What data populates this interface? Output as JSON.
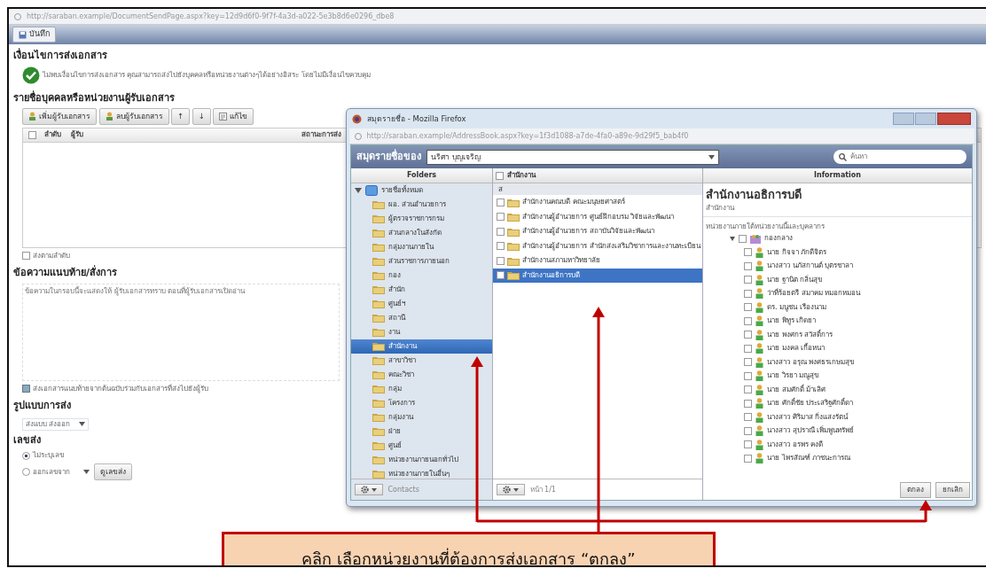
{
  "browser": {
    "url": "http://saraban.example/DocumentSendPage.aspx?key=12d9d6f0-9f7f-4a3d-a022-5e3b8d6e0296_dbe8"
  },
  "toolbar": {
    "buttons": [
      "บันทึก"
    ]
  },
  "conditions": {
    "heading": "เงื่อนไขการส่งเอกสาร",
    "message": "ไม่พบเงื่อนไขการส่งเอกสาร คุณสามารถส่งไปยังบุคคลหรือหน่วยงานต่างๆได้อย่างอิสระ โดยไม่มีเงื่อนไขควบคุม"
  },
  "recipients": {
    "heading": "รายชื่อบุคคลหรือหน่วยงานผู้รับเอกสาร",
    "buttons": [
      {
        "label": "เพิ่มผู้รับเอกสาร",
        "kind": "add"
      },
      {
        "label": "ลบผู้รับเอกสาร",
        "kind": "remove"
      },
      {
        "label": "↑",
        "kind": "up"
      },
      {
        "label": "↓",
        "kind": "down"
      },
      {
        "label": "แก้ไข",
        "kind": "edit"
      }
    ],
    "columns": [
      "ลำดับ",
      "ผู้รับ",
      "สถานะการส่ง"
    ],
    "select_all": {
      "checked": false
    },
    "send_in_order": {
      "label": "ส่งตามลำดับ",
      "checked": false
    }
  },
  "note": {
    "heading": "ข้อความแนบท้าย/สั่งการ",
    "placeholder": "ข้อความในกรอบนี้จะแสดงให้ ผู้รับเอกสารทราบ ตอนที่ผู้รับเอกสารเปิดอ่าน",
    "attach": {
      "label": "ส่งเอกสารแนบท้ายจากต้นฉบับร่วมกับเอกสารที่ส่งไปยังผู้รับ",
      "checked": true
    }
  },
  "send_mode": {
    "heading": "รูปแบบการส่ง",
    "value": "ส่งแบบ ส่งออก"
  },
  "send_number": {
    "heading": "เลขส่ง",
    "options": [
      {
        "label": "ไม่ระบุเลข",
        "selected": true,
        "kind": "plain"
      },
      {
        "label": "ออกเลขจาก",
        "selected": false,
        "kind": "select"
      }
    ],
    "button": "ดูเลขส่ง"
  },
  "popup": {
    "title": "สมุดรายชื่อ - Mozilla Firefox",
    "url": "http://saraban.example/AddressBook.aspx?key=1f3d1088-a7de-4fa0-a89e-9d29f5_bab4f0",
    "book_label": "สมุดรายชื่อของ",
    "book_owner": "นริศา บุญเจริญ",
    "search_placeholder": "ค้นหา",
    "folders_heading": "Folders",
    "folders": [
      {
        "label": "รายชื่อทั้งหมด",
        "selected": false,
        "expanded": true,
        "children": [
          {
            "label": "ผอ. ส่วนอำนวยการ",
            "selected": false
          },
          {
            "label": "ผู้ตรวจราชการกรม",
            "selected": false
          },
          {
            "label": "ส่วนกลางในสังกัด",
            "selected": false
          },
          {
            "label": "กลุ่มงานภายใน",
            "selected": false
          },
          {
            "label": "ส่วนราชการภายนอก",
            "selected": false
          },
          {
            "label": "กอง",
            "selected": false
          },
          {
            "label": "สำนัก",
            "selected": false
          },
          {
            "label": "ศูนย์ฯ",
            "selected": false
          },
          {
            "label": "สถานี",
            "selected": false
          },
          {
            "label": "งาน",
            "selected": false
          },
          {
            "label": "สำนักงาน",
            "selected": true
          },
          {
            "label": "สาขาวิชา",
            "selected": false
          },
          {
            "label": "คณะวิชา",
            "selected": false
          },
          {
            "label": "กลุ่ม",
            "selected": false
          },
          {
            "label": "โครงการ",
            "selected": false
          },
          {
            "label": "กลุ่มงาน",
            "selected": false
          },
          {
            "label": "ฝ่าย",
            "selected": false
          },
          {
            "label": "ศูนย์",
            "selected": false
          },
          {
            "label": "หน่วยงานภายนอกทั่วไป",
            "selected": false
          },
          {
            "label": "หน่วยงานภายในอื่นๆ",
            "selected": false
          }
        ]
      }
    ],
    "folders_footer": "Contacts",
    "list_heading": "สำนักงาน",
    "list_select_all": {
      "checked": false
    },
    "group_letter": "ส",
    "items": [
      {
        "label": "สำนักงานคณบดี คณะมนุษยศาสตร์",
        "selected": false
      },
      {
        "label": "สำนักงานผู้อำนวยการ ศูนย์ฝึกอบรม วิจัยและพัฒนา",
        "selected": false
      },
      {
        "label": "สำนักงานผู้อำนวยการ สถาบันวิจัยและพัฒนา",
        "selected": false
      },
      {
        "label": "สำนักงานผู้อำนวยการ สำนักส่งเสริมวิชาการและงานทะเบียน",
        "selected": false
      },
      {
        "label": "สำนักงานสภามหาวิทยาลัย",
        "selected": false
      },
      {
        "label": "สำนักงานอธิการบดี",
        "selected": true
      }
    ],
    "list_footer": "หน้า 1/1",
    "info_heading": "Information",
    "info_title": "สำนักงานอธิการบดี",
    "info_type": "สำนักงาน",
    "info_caption": "หน่วยงานภายใต้หน่วยงานนี้และบุคลากร",
    "info_tree": [
      {
        "label": "กองกลาง",
        "expanded": true,
        "checked": false,
        "children": [
          {
            "label": "นาย กิจจา ภักดีจิตร",
            "checked": false
          },
          {
            "label": "นางสาว นภัสกานต์ บุตรชาลา",
            "checked": false
          },
          {
            "label": "นาย ฐานิต กลิ่นสุข",
            "checked": false
          },
          {
            "label": "ว่าที่ร้อยตรี สมาคม หมอกหมอน",
            "checked": false
          },
          {
            "label": "ดร. มนูชน เรืองนาม",
            "checked": false
          },
          {
            "label": "นาย พิทูร เกิดยา",
            "checked": false
          },
          {
            "label": "นาย พงศกร สวัสดิ์การ",
            "checked": false
          },
          {
            "label": "นาย มงคล เกื้อหนา",
            "checked": false
          },
          {
            "label": "นางสาว อรุณ พงศธรเกษมสุข",
            "checked": false
          },
          {
            "label": "นาย วิรยา มณูสุข",
            "checked": false
          },
          {
            "label": "นาย สมศักดิ์ ม้าเลิศ",
            "checked": false
          },
          {
            "label": "นาย ศักดิ์ชัย ประเสริฐศักดิ์ดา",
            "checked": false
          },
          {
            "label": "นางสาว ศิริมาส กิ่งแสงรัตน์",
            "checked": false
          },
          {
            "label": "นางสาว สุปราณี เพิ่มพูนทรัพย์",
            "checked": false
          },
          {
            "label": "นางสาว อรพร คงดี",
            "checked": false
          },
          {
            "label": "นาย ไพรสัณฑ์ ภาชนะการณ",
            "checked": false
          }
        ]
      }
    ],
    "buttons": [
      "ตกลง",
      "ยกเลิก"
    ]
  },
  "callout": {
    "text": "คลิก เลือกหน่วยงานที่ต้องการส่งเอกสาร “ตกลง”"
  }
}
